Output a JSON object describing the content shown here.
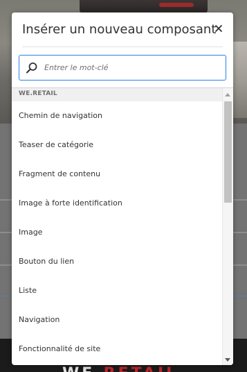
{
  "background": {
    "brand_part1": "WE.",
    "brand_part2": "RETAIL"
  },
  "dialog": {
    "title": "Insérer un nouveau composant",
    "close_icon": "close-icon",
    "search": {
      "placeholder": "Entrer le mot-clé",
      "value": "",
      "icon": "search-icon"
    },
    "group_label": "WE.RETAIL",
    "items": [
      {
        "label": "Chemin de navigation"
      },
      {
        "label": "Teaser de catégorie"
      },
      {
        "label": "Fragment de contenu"
      },
      {
        "label": "Image à forte identification"
      },
      {
        "label": "Image"
      },
      {
        "label": "Bouton du lien"
      },
      {
        "label": "Liste"
      },
      {
        "label": "Navigation"
      },
      {
        "label": "Fonctionnalité de site"
      }
    ]
  },
  "colors": {
    "accent": "#2680eb",
    "brand_red": "#c0262c",
    "text": "#323232"
  }
}
